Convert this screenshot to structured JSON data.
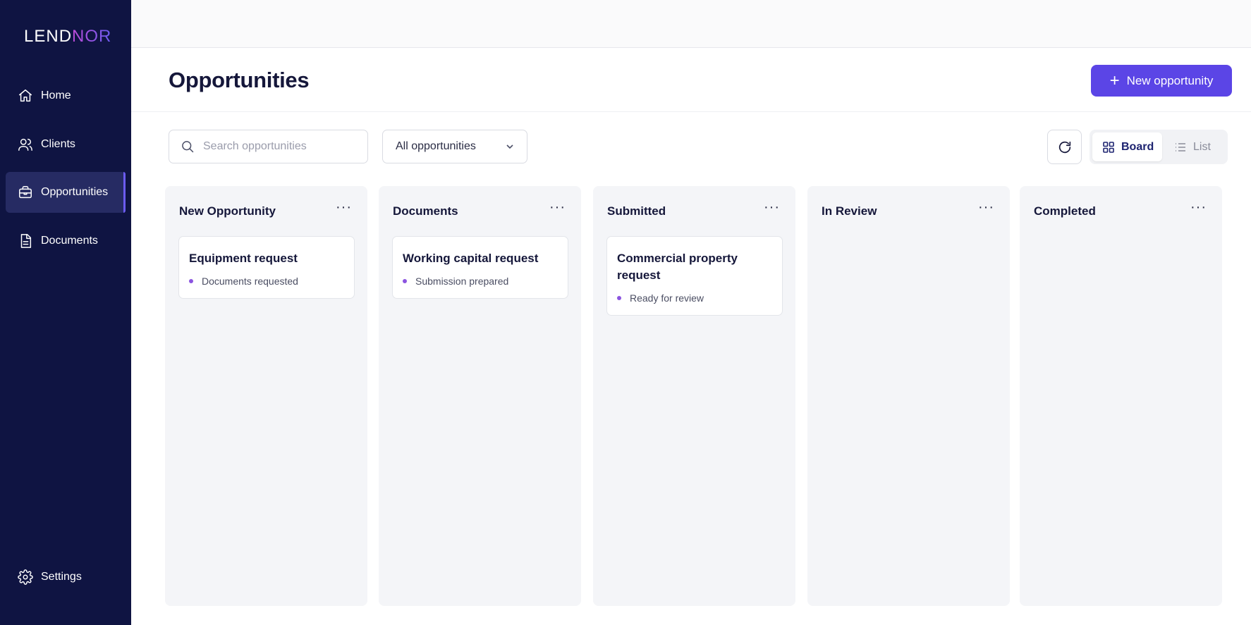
{
  "app": {
    "logo_part1": "LEND",
    "logo_part2": "NOR"
  },
  "sidebar": {
    "items": [
      {
        "label": "Home",
        "icon": "home-icon"
      },
      {
        "label": "Clients",
        "icon": "users-icon"
      },
      {
        "label": "Opportunities",
        "icon": "briefcase-icon",
        "active": true
      },
      {
        "label": "Documents",
        "icon": "document-icon"
      }
    ],
    "settings_label": "Settings",
    "settings_icon": "gear-icon"
  },
  "header": {
    "title": "Opportunities",
    "new_button_label": "New opportunity"
  },
  "toolbar": {
    "search_placeholder": "Search opportunities",
    "search_value": "",
    "filter_selected": "All opportunities",
    "view_board_label": "Board",
    "view_list_label": "List",
    "active_view": "Board"
  },
  "board": {
    "columns": [
      {
        "title": "New Opportunity",
        "cards": [
          {
            "title": "Equipment request",
            "status": "Documents requested"
          }
        ]
      },
      {
        "title": "Documents",
        "cards": [
          {
            "title": "Working capital request",
            "status": "Submission prepared"
          }
        ]
      },
      {
        "title": "Submitted",
        "cards": [
          {
            "title": "Commercial property request",
            "status": "Ready for review"
          }
        ]
      },
      {
        "title": "In Review",
        "cards": []
      },
      {
        "title": "Completed",
        "cards": []
      }
    ]
  },
  "colors": {
    "sidebar_bg": "#0f1442",
    "accent": "#5b45e6",
    "status_dot": "#8b54e0",
    "column_bg": "#f4f5f8"
  }
}
